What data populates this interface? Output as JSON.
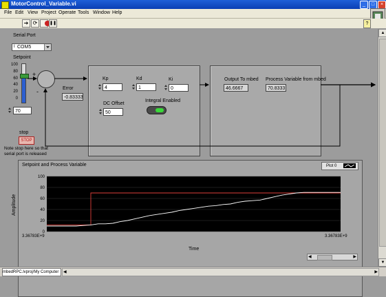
{
  "window": {
    "title": "MotorControl_Variable.vi",
    "buttons": {
      "minimize": "_",
      "maximize": "□",
      "close": "×"
    }
  },
  "menu": [
    "File",
    "Edit",
    "View",
    "Project",
    "Operate",
    "Tools",
    "Window",
    "Help"
  ],
  "toolbar": {
    "icons": [
      "run-arrow-icon",
      "run-continuously-icon",
      "abort-icon",
      "pause-icon"
    ],
    "glyphs": {
      "run": "➔",
      "continuous": "⟳",
      "pause": "❚❚"
    },
    "help_glyph": "?"
  },
  "serial_port": {
    "label": "Serial Port",
    "prefix": "I",
    "value": "COM5"
  },
  "setpoint": {
    "label": "Setpoint",
    "scale": [
      "100",
      "80",
      "60",
      "40",
      "20",
      "0"
    ],
    "level": 0.7,
    "value": "70"
  },
  "summing": {
    "plus": "+",
    "minus": "-"
  },
  "error": {
    "label": "Error",
    "value": "-0.83333"
  },
  "pid": {
    "kp": {
      "label": "Kp",
      "value": "4"
    },
    "kd": {
      "label": "Kd",
      "value": "1"
    },
    "ki": {
      "label": "Ki",
      "value": "0"
    },
    "dc_offset": {
      "label": "DC Offset",
      "value": "50"
    },
    "integral": {
      "label": "Integral Enabled",
      "on": true
    }
  },
  "output": {
    "out_label": "Output To mbed",
    "out_value": "46.6667",
    "pv_label": "Process Variable from mbed",
    "pv_value": "70.8333"
  },
  "stop": {
    "label": "stop",
    "button": "STOP",
    "note": "Note stop here so that serial port is released"
  },
  "colors": {
    "setpoint_line": "#e0403a",
    "pv_line": "#ffffff",
    "knob": "#3a9a3a",
    "led_on": "#39d839",
    "slider_fill": "#2c5fd0"
  },
  "chart_data": {
    "type": "line",
    "title": "Setpoint and Process Variable",
    "xlabel": "Time",
    "ylabel": "Amplitude",
    "legend": "Plot 0",
    "ylim": [
      0,
      100
    ],
    "yticks": [
      "100",
      "80",
      "60",
      "40",
      "20",
      "0"
    ],
    "x_start_label": "3.36783E+9",
    "x_end_label": "3.36783E+9",
    "x": [
      0,
      1,
      2,
      3,
      4,
      5,
      6,
      7,
      8,
      9,
      10,
      11,
      12,
      13,
      14,
      15,
      16,
      17,
      18,
      19,
      20,
      21,
      22,
      23,
      24,
      25,
      26,
      27,
      28,
      29,
      30,
      31,
      32,
      33,
      34,
      35,
      36,
      37,
      38,
      39,
      40
    ],
    "series": [
      {
        "values": [
          12,
          12,
          12,
          12,
          12,
          12,
          70,
          70,
          70,
          70,
          70,
          70,
          70,
          70,
          70,
          70,
          70,
          70,
          70,
          70,
          70,
          70,
          70,
          70,
          70,
          70,
          70,
          70,
          70,
          70,
          70,
          70,
          70,
          70,
          70,
          70,
          70,
          70,
          70,
          70,
          70
        ]
      },
      {
        "values": [
          10,
          10,
          10,
          10,
          10,
          11,
          12,
          14,
          14,
          15,
          18,
          20,
          23,
          26,
          29,
          31,
          33,
          35,
          38,
          40,
          42,
          44,
          46,
          47,
          49,
          50,
          53,
          55,
          56,
          57,
          60,
          63,
          66,
          68,
          70,
          71,
          71,
          71,
          71,
          71,
          71
        ]
      }
    ]
  }
}
